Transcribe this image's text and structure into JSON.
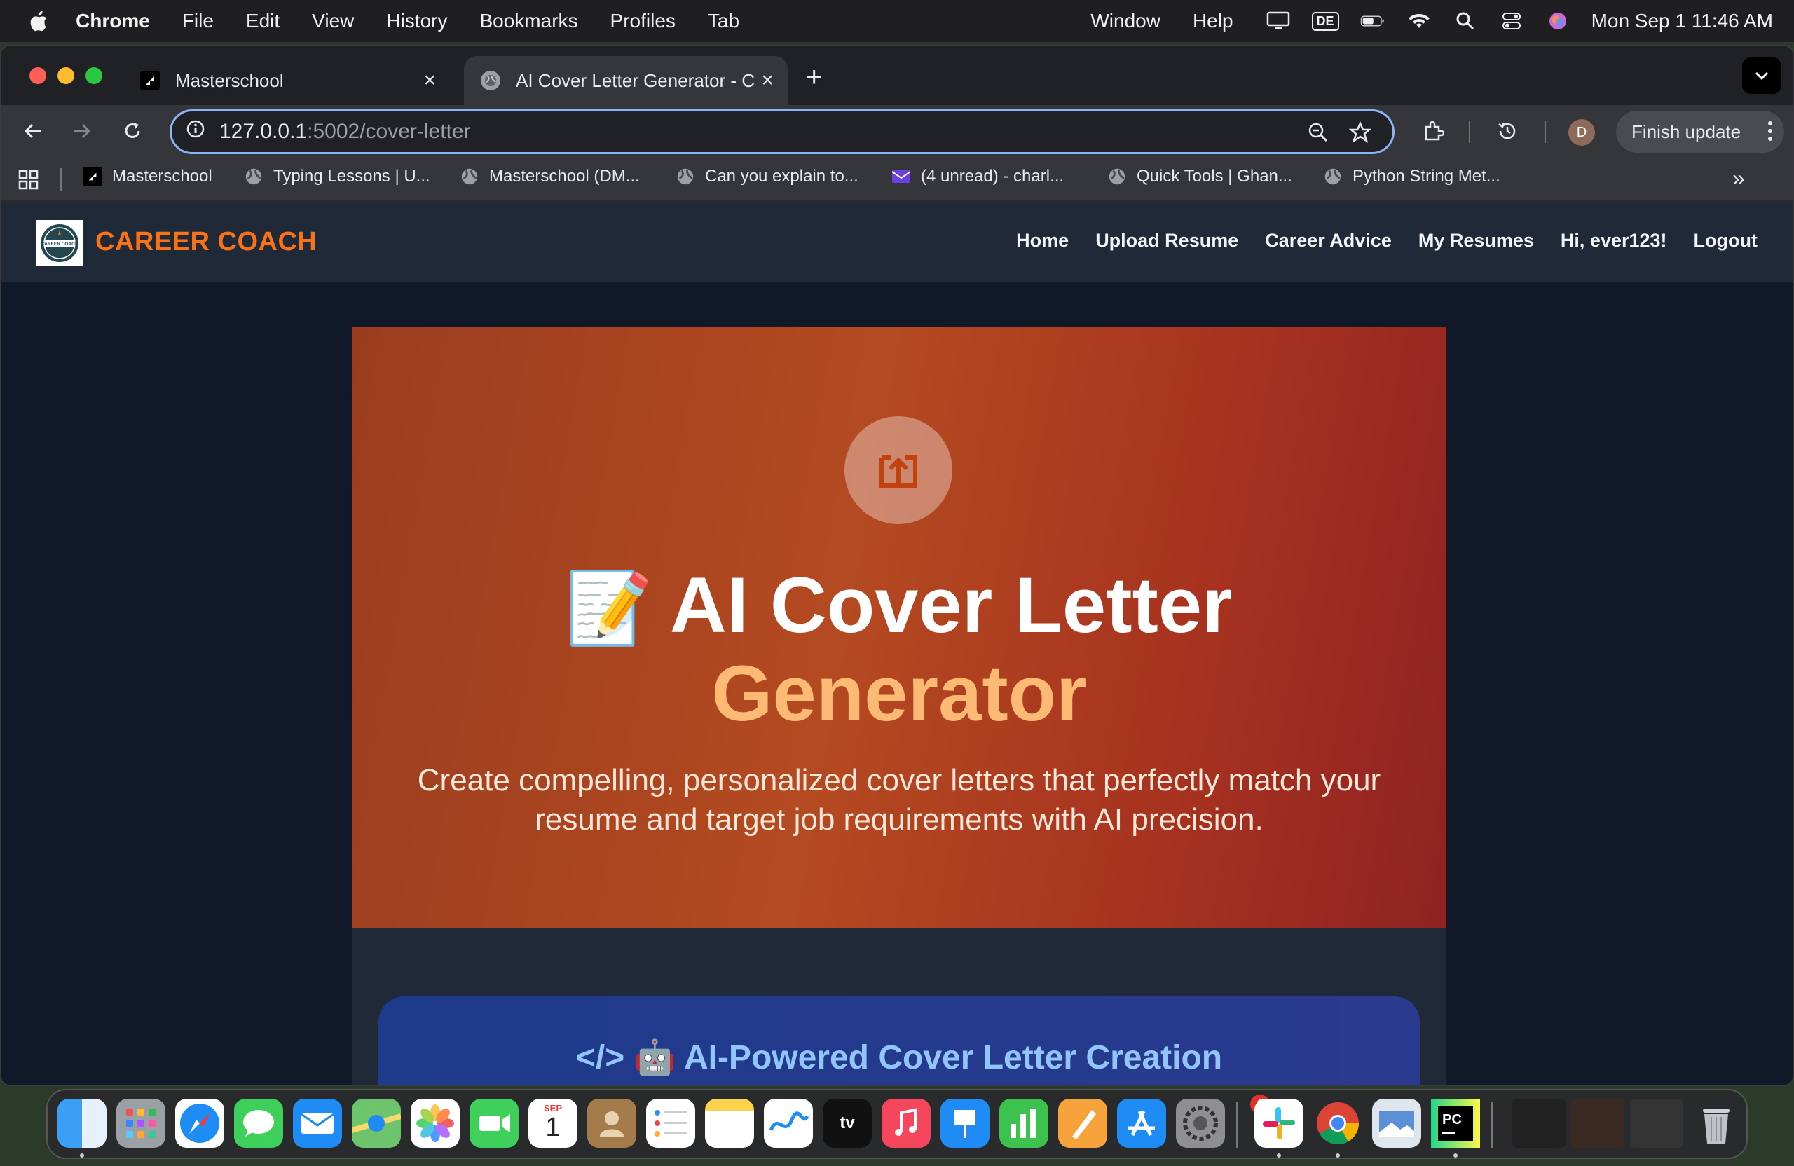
{
  "menubar": {
    "app_name": "Chrome",
    "items": [
      "File",
      "Edit",
      "View",
      "History",
      "Bookmarks",
      "Profiles",
      "Tab",
      "Window",
      "Help"
    ],
    "keyboard_layout": "DE",
    "datetime": "Mon Sep 1  11:46 AM"
  },
  "tabs": [
    {
      "title": "Masterschool",
      "active": false
    },
    {
      "title": "AI Cover Letter Generator - C",
      "active": true
    }
  ],
  "toolbar": {
    "url_host": "127.0.0.1",
    "url_path": ":5002/cover-letter",
    "finish_update": "Finish update",
    "profile_initial": "D"
  },
  "bookmarks": [
    "Masterschool",
    "Typing Lessons | U...",
    "Masterschool (DM...",
    "Can you explain to...",
    "(4 unread) - charl...",
    "Quick Tools | Ghan...",
    "Python String Met..."
  ],
  "site": {
    "logo_text": "CAREER COACH",
    "logo_badge": "CAREER COACH",
    "nav": [
      "Home",
      "Upload Resume",
      "Career Advice",
      "My Resumes",
      "Hi, ever123!",
      "Logout"
    ],
    "accent": "#f97316"
  },
  "hero": {
    "emoji": "📝",
    "title_line1": "AI Cover Letter",
    "title_line2": "Generator",
    "subtitle": "Create compelling, personalized cover letters that perfectly match your resume and target job requirements with AI precision."
  },
  "feature": {
    "title": "</> 🤖 AI-Powered Cover Letter Creation"
  },
  "dock": {
    "calendar_month": "SEP",
    "calendar_day": "1",
    "settings_badge": "1",
    "apps": [
      "Finder",
      "Launchpad",
      "Safari",
      "Messages",
      "Mail",
      "Maps",
      "Photos",
      "FaceTime",
      "Calendar",
      "Contacts",
      "Reminders",
      "Notes",
      "Freeform",
      "TV",
      "Music",
      "Keynote",
      "Numbers",
      "Pages",
      "App Store",
      "System Settings",
      "Slack",
      "Chrome",
      "Preview",
      "PyCharm",
      "Trash"
    ]
  }
}
